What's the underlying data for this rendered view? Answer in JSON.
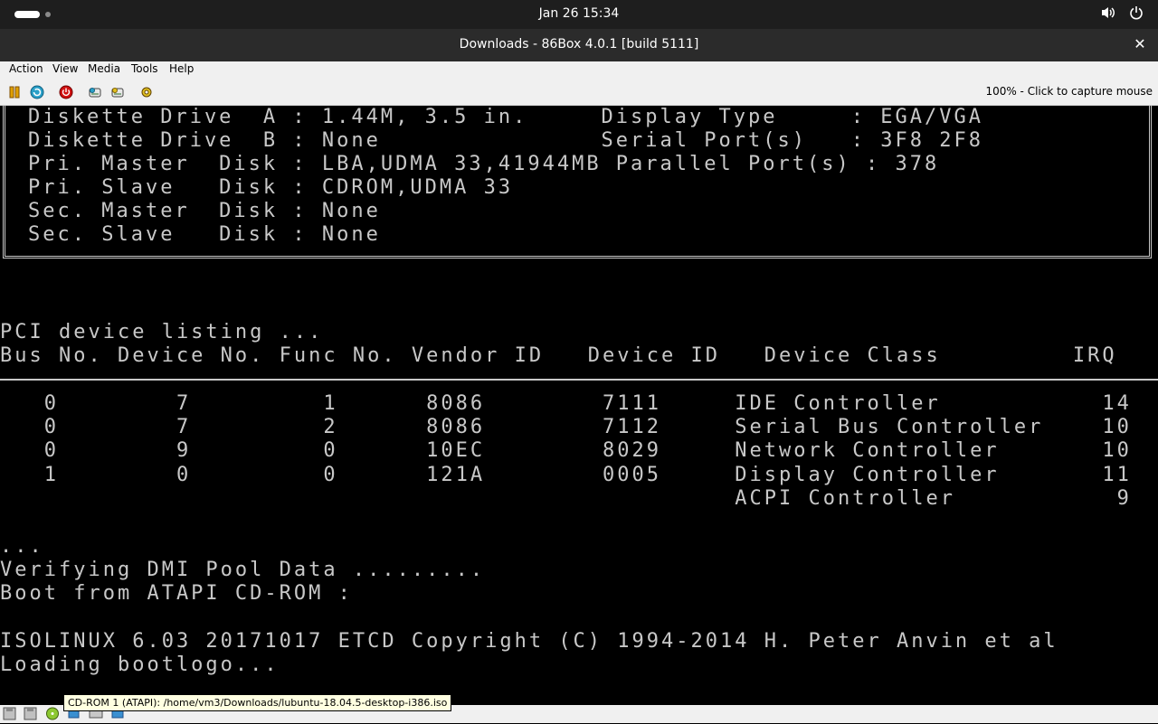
{
  "topbar": {
    "clock": "Jan 26  15:34"
  },
  "window": {
    "title": "Downloads - 86Box 4.0.1 [build 5111]"
  },
  "menu": [
    "Action",
    "View",
    "Media",
    "Tools",
    "Help"
  ],
  "toolbar": {
    "icons": [
      "pause-icon",
      "reset-icon",
      "power-icon",
      "ctrl-alt-del-icon",
      "ctrl-alt-esc-icon",
      "settings-icon"
    ],
    "capture_hint": "100% - Click to capture mouse"
  },
  "bios": {
    "config_lines": [
      "Diskette Drive  A : 1.44M, 3.5 in.     Display Type     : EGA/VGA",
      "Diskette Drive  B : None               Serial Port(s)   : 3F8 2F8",
      "Pri. Master  Disk : LBA,UDMA 33,41944MB Parallel Port(s) : 378",
      "Pri. Slave   Disk : CDROM,UDMA 33",
      "Sec. Master  Disk : None",
      "Sec. Slave   Disk : None"
    ],
    "pci_title": "PCI device listing ...",
    "pci_header": "Bus No. Device No. Func No. Vendor ID   Device ID   Device Class         IRQ",
    "pci_rows": [
      "   0        7         1      8086        7111     IDE Controller           14",
      "   0        7         2      8086        7112     Serial Bus Controller    10",
      "   0        9         0      10EC        8029     Network Controller       10",
      "   1        0         0      121A        0005     Display Controller       11",
      "                                                  ACPI Controller           9"
    ],
    "post_lines": [
      "...",
      "Verifying DMI Pool Data .........",
      "Boot from ATAPI CD-ROM :",
      "",
      "ISOLINUX 6.03 20171017 ETCD Copyright (C) 1994-2014 H. Peter Anvin et al",
      "Loading bootlogo..."
    ]
  },
  "statusbar": {
    "icons": [
      "floppy-a-icon",
      "floppy-b-icon",
      "cdrom-icon",
      "network-icon",
      "hdd-icon",
      "sound-icon"
    ],
    "tooltip": "CD-ROM 1 (ATAPI): /home/vm3/Downloads/lubuntu-18.04.5-desktop-i386.iso"
  }
}
